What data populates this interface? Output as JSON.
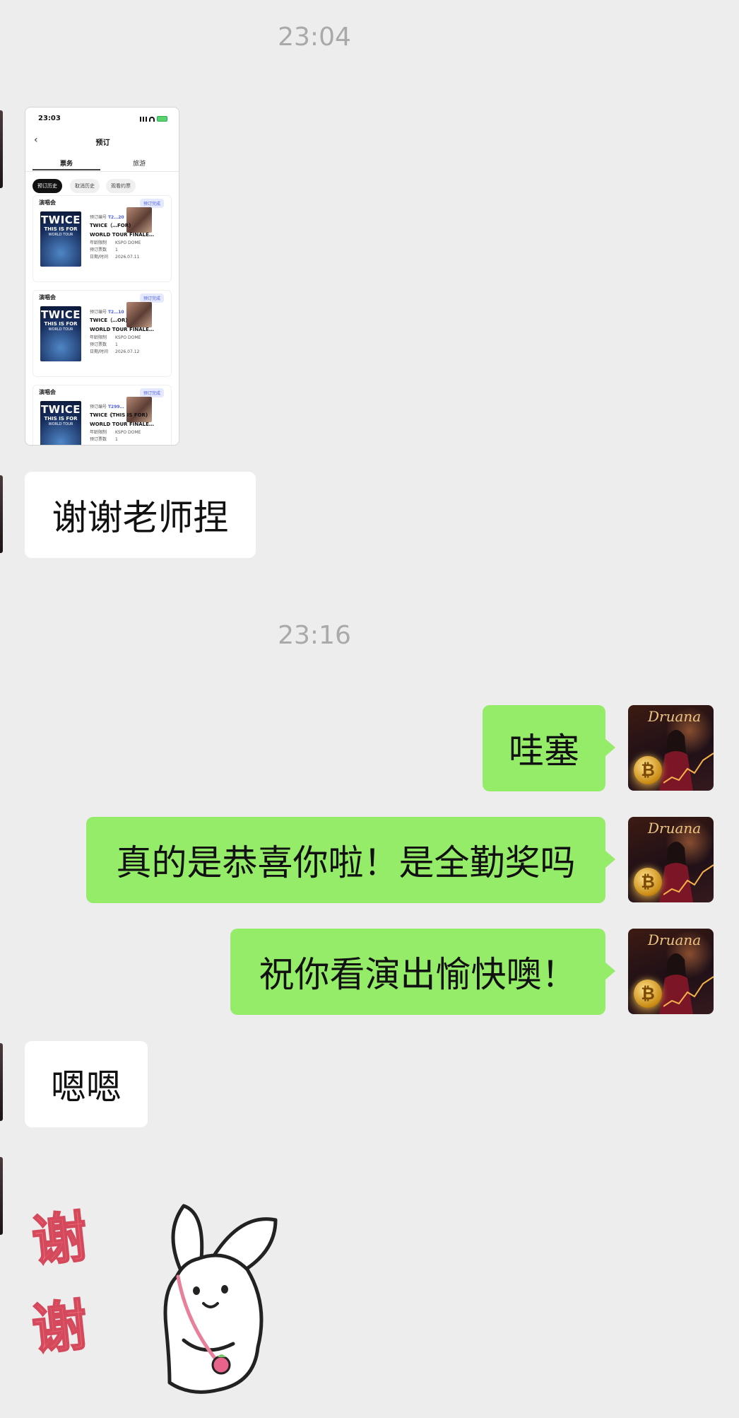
{
  "messages": {
    "time1": "23:04",
    "time2": "23:16",
    "thanks": "谢谢老师捏",
    "wow": "哇塞",
    "congrats": "真的是恭喜你啦！是全勤奖吗",
    "enjoy": "祝你看演出愉快噢！",
    "ok": "嗯嗯"
  },
  "screenshot": {
    "status_time": "23:03",
    "back": "‹",
    "title": "预订",
    "tabs": [
      "票务",
      "旅游"
    ],
    "chips": [
      "预订历史",
      "取消历史",
      "观看约票"
    ],
    "cards": [
      {
        "category": "演唱会",
        "badge": "预订完成",
        "id_label": "预订编号",
        "id_value": "T2…20",
        "name1": "TWICE（…FOR)",
        "name2": "WORLD TOUR FINALE…",
        "venue_label": "年龄限制",
        "venue": "KSPO DOME",
        "qty_label": "预订票数",
        "qty": "1",
        "date_label": "日期/时间",
        "date": "2026.07.11"
      },
      {
        "category": "演唱会",
        "badge": "预订完成",
        "id_label": "预订编号",
        "id_value": "T2…10",
        "name1": "TWICE（…OR)",
        "name2": "WORLD TOUR FINALE…",
        "venue_label": "年龄限制",
        "venue": "KSPO DOME",
        "qty_label": "预订票数",
        "qty": "1",
        "date_label": "日期/时间",
        "date": "2026.07.12"
      },
      {
        "category": "演唱会",
        "badge": "预订完成",
        "id_label": "预订编号",
        "id_value": "T299…",
        "name1": "TWICE《THIS IS FOR)",
        "name2": "WORLD TOUR FINALE…",
        "venue_label": "年龄限制",
        "venue": "KSPO DOME",
        "qty_label": "预订票数",
        "qty": "1",
        "date_label": "",
        "date": ""
      }
    ],
    "poster_line1": "TWICE",
    "poster_line2": "THIS IS FOR",
    "poster_line3": "WORLD TOUR"
  },
  "avatar": {
    "title": "Druana",
    "coin_symbol": "₿"
  },
  "sticker": {
    "char1": "谢",
    "char2": "谢"
  },
  "colors": {
    "background": "#ededed",
    "bubble_self": "#95ec69",
    "bubble_other": "#ffffff",
    "timestamp": "#a9a9a9"
  }
}
